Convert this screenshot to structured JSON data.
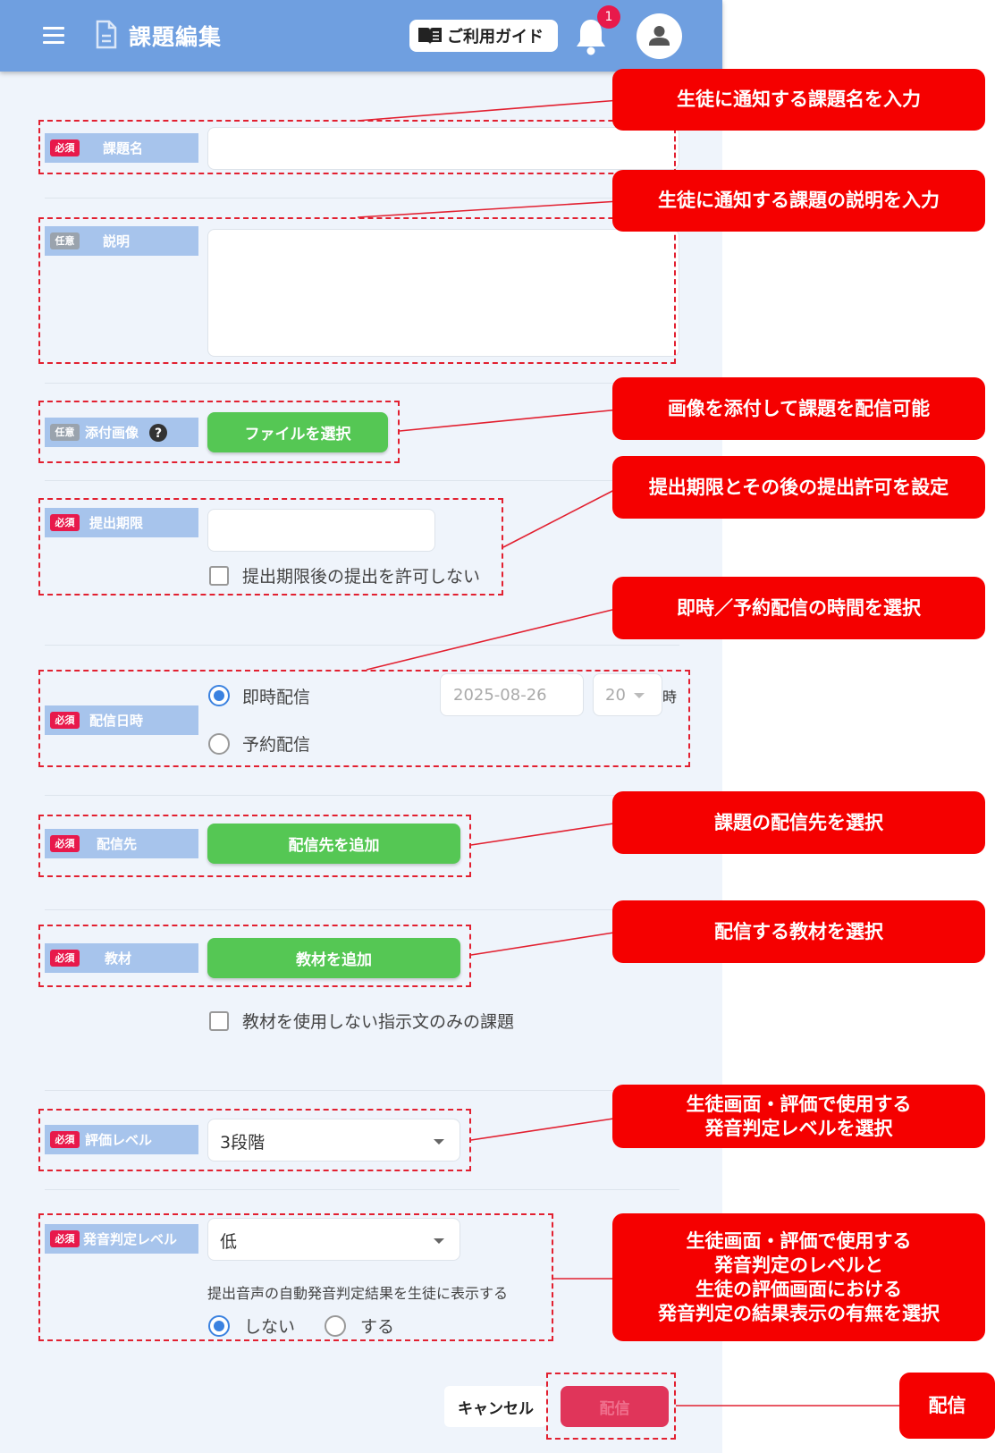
{
  "header": {
    "title": "課題編集",
    "guide_label": "ご利用ガイド",
    "notification_count": "1"
  },
  "tags": {
    "required": "必須",
    "optional": "任意"
  },
  "fields": {
    "title": {
      "label": "課題名",
      "value": ""
    },
    "description": {
      "label": "説明",
      "value": ""
    },
    "image": {
      "label": "添付画像",
      "button": "ファイルを選択"
    },
    "deadline": {
      "label": "提出期限",
      "value": "",
      "checkbox_label": "提出期限後の提出を許可しない",
      "checked": false
    },
    "delivery_time": {
      "label": "配信日時",
      "options": [
        "即時配信",
        "予約配信"
      ],
      "selected": "即時配信",
      "date": "2025-08-26",
      "hour": "20",
      "hour_unit": "時"
    },
    "recipients": {
      "label": "配信先",
      "button": "配信先を追加"
    },
    "material": {
      "label": "教材",
      "button": "教材を追加",
      "checkbox_label": "教材を使用しない指示文のみの課題",
      "checked": false
    },
    "evaluation_level": {
      "label": "評価レベル",
      "value": "3段階"
    },
    "pronunciation_level": {
      "label": "発音判定レベル",
      "value": "低",
      "display_note": "提出音声の自動発音判定結果を生徒に表示する",
      "options": [
        "しない",
        "する"
      ],
      "selected": "しない"
    }
  },
  "actions": {
    "cancel": "キャンセル",
    "submit": "配信"
  },
  "callouts": [
    "生徒に通知する課題名を入力",
    "生徒に通知する課題の説明を入力",
    "画像を添付して課題を配信可能",
    "提出期限とその後の提出許可を設定",
    "即時／予約配信の時間を選択",
    "課題の配信先を選択",
    "配信する教材を選択",
    "生徒画面・評価で使用する\n発音判定レベルを選択",
    "生徒画面・評価で使用する\n発音判定のレベルと\n生徒の評価画面における\n発音判定の結果表示の有無を選択",
    "配信"
  ],
  "colors": {
    "header": "#6f9fe0",
    "label_bg": "#a7c4ec",
    "required_tag": "#e8194b",
    "green_button": "#55c754",
    "callout": "#f50000",
    "submit": "#e0355a"
  }
}
